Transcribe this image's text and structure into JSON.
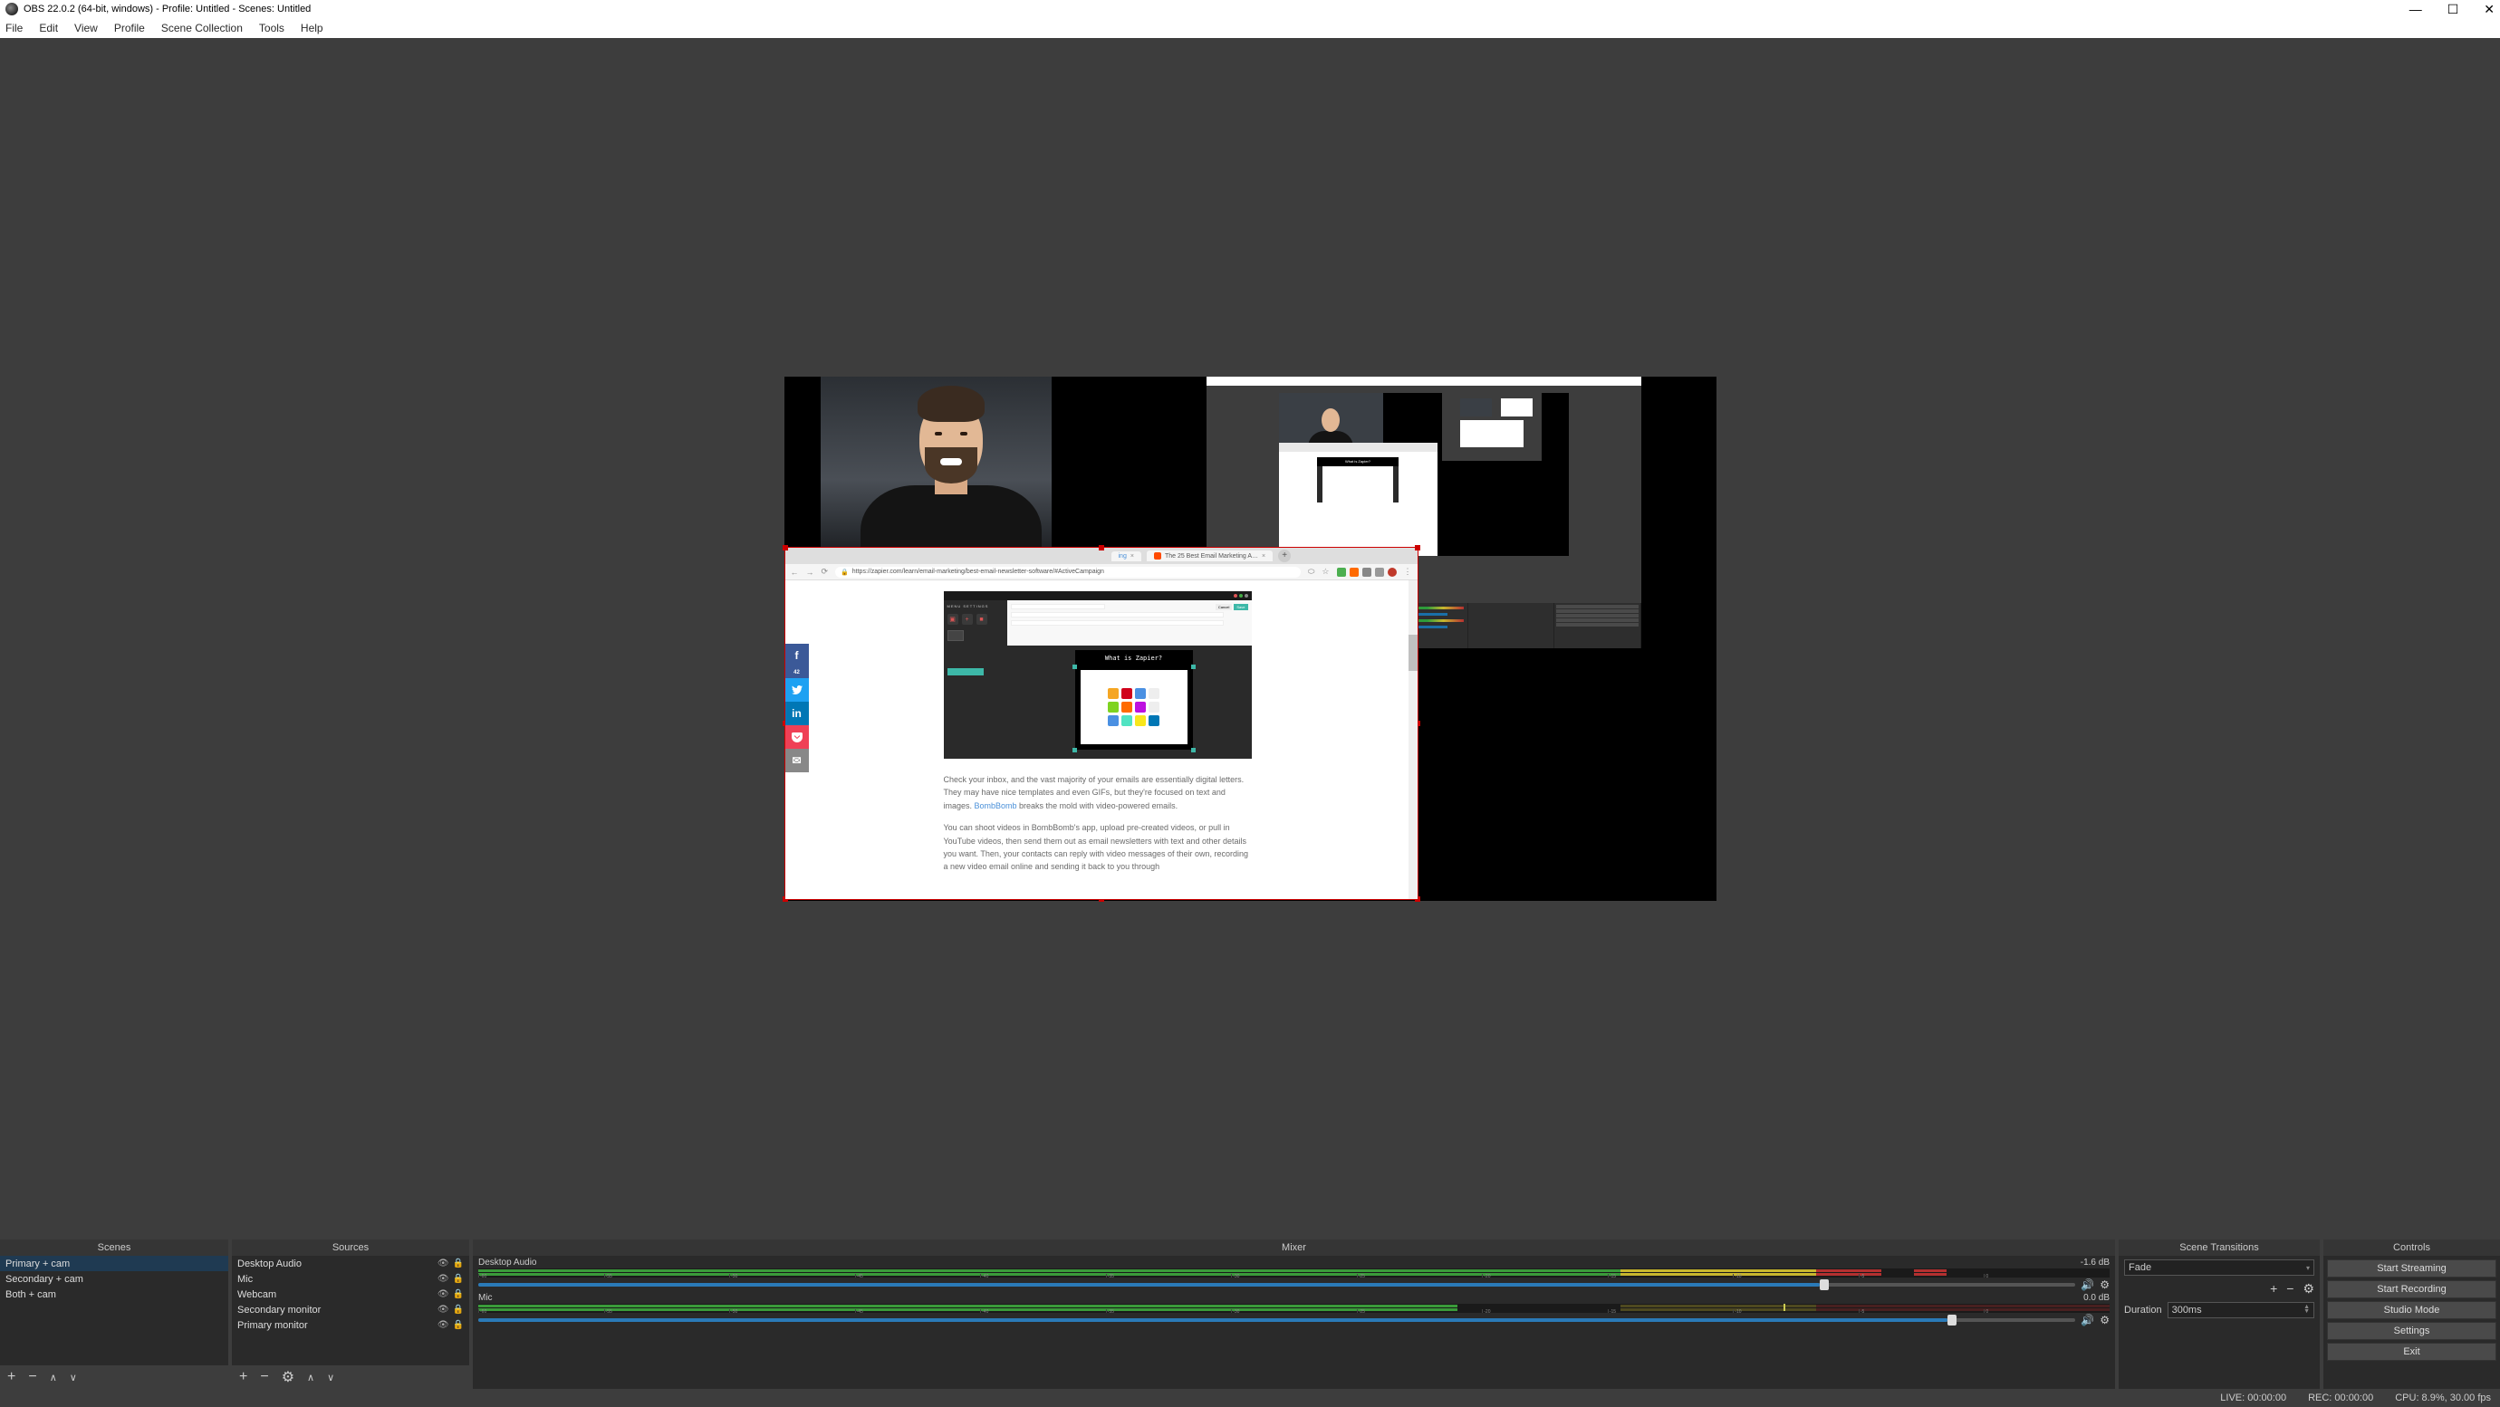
{
  "window": {
    "title": "OBS 22.0.2 (64-bit, windows) - Profile: Untitled - Scenes: Untitled"
  },
  "menu": {
    "items": [
      "File",
      "Edit",
      "View",
      "Profile",
      "Scene Collection",
      "Tools",
      "Help"
    ]
  },
  "canvas": {
    "browser": {
      "tab_title": "The 25 Best Email Marketing A…",
      "url": "https://zapier.com/learn/email-marketing/best-email-newsletter-software/#ActiveCampaign",
      "article": {
        "card_title": "What is Zapier?",
        "sidebar_label": "MENU SETTINGS",
        "share_fb_count": "42",
        "paragraph1_a": "Check your inbox, and the vast majority of your emails are essentially digital letters. They may have nice templates and even GIFs, but they're focused on text and images. ",
        "paragraph1_link": "BombBomb",
        "paragraph1_b": " breaks the mold with video-powered emails.",
        "paragraph2": "You can shoot videos in BombBomb's app, upload pre-created videos, or pull in YouTube videos, then send them out as email newsletters with text and other details you want. Then, your contacts can reply with video messages of their own, recording a new video email online and sending it back to you through"
      }
    }
  },
  "docks": {
    "scenes": {
      "header": "Scenes",
      "items": [
        {
          "label": "Primary + cam",
          "selected": true
        },
        {
          "label": "Secondary + cam",
          "selected": false
        },
        {
          "label": "Both + cam",
          "selected": false
        }
      ]
    },
    "sources": {
      "header": "Sources",
      "items": [
        {
          "label": "Desktop Audio"
        },
        {
          "label": "Mic"
        },
        {
          "label": "Webcam"
        },
        {
          "label": "Secondary monitor"
        },
        {
          "label": "Primary monitor"
        }
      ]
    },
    "mixer": {
      "header": "Mixer",
      "channels": [
        {
          "name": "Desktop Audio",
          "db": "-1.6 dB",
          "slider_pct": 84
        },
        {
          "name": "Mic",
          "db": "0.0 dB",
          "slider_pct": 92
        }
      ],
      "ticks": [
        "-60",
        "-55",
        "-50",
        "-45",
        "-40",
        "-35",
        "-30",
        "-25",
        "-20",
        "-15",
        "-10",
        "-5",
        "0"
      ]
    },
    "transitions": {
      "header": "Scene Transitions",
      "type": "Fade",
      "duration_label": "Duration",
      "duration_value": "300ms"
    },
    "controls": {
      "header": "Controls",
      "buttons": [
        "Start Streaming",
        "Start Recording",
        "Studio Mode",
        "Settings",
        "Exit"
      ]
    }
  },
  "statusbar": {
    "live": "LIVE: 00:00:00",
    "rec": "REC: 00:00:00",
    "cpu": "CPU: 8.9%, 30.00 fps"
  }
}
